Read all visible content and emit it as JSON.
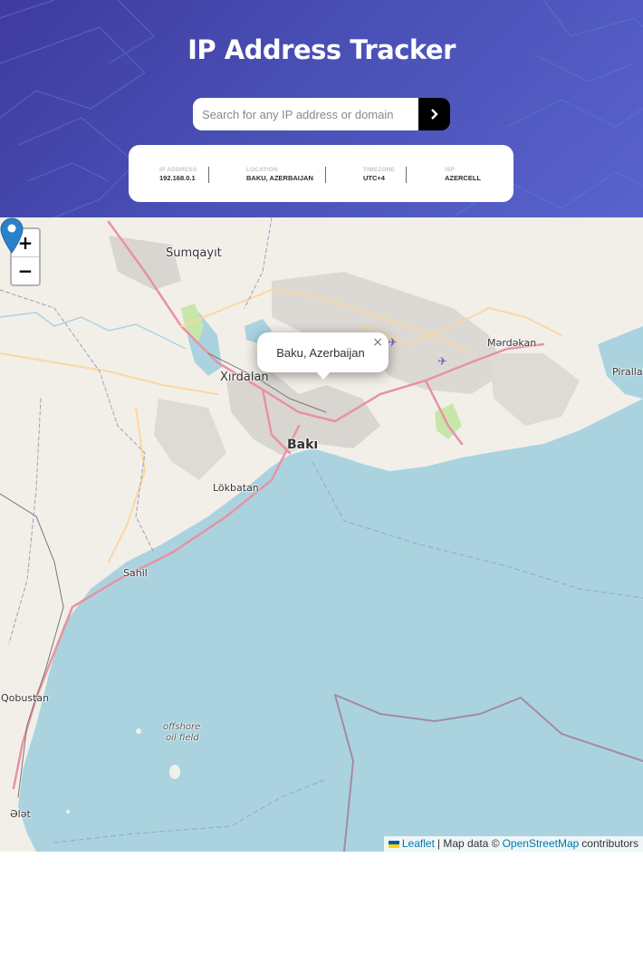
{
  "header": {
    "title": "IP Address Tracker",
    "search_placeholder": "Search for any IP address or domain",
    "search_value": ""
  },
  "info": {
    "ip_label": "IP ADDRESS",
    "ip_value": "192.168.0.1",
    "location_label": "LOCATION",
    "location_value": "BAKU, AZERBAIJAN",
    "timezone_label": "TIMEZONE",
    "timezone_value": "UTC+4",
    "isp_label": "ISP",
    "isp_value": "AZERCELL"
  },
  "map": {
    "zoom_in": "+",
    "zoom_out": "−",
    "popup_text": "Baku, Azerbaijan",
    "popup_close": "×",
    "places": {
      "sumqayit": "Sumqayıt",
      "mardakan": "Mərdəkan",
      "pirallahi": "Pirallah",
      "xirdalan": "Xırdalan",
      "baki": "Bakı",
      "lokbatan": "Lökbatan",
      "sahil": "Sahil",
      "qobustan": "Qobustan",
      "offshore1": "offshore",
      "offshore2": "oil field",
      "alat": "Ələt"
    },
    "attribution": {
      "leaflet": "Leaflet",
      "sep": "| Map data ©",
      "osm": "OpenStreetMap",
      "contributors": "contributors"
    }
  },
  "colors": {
    "header_gradient_start": "#3f3a9e",
    "header_gradient_end": "#5a63cc",
    "sea": "#aad3df",
    "land": "#f2efe9",
    "marker": "#2a81cb",
    "link": "#0078a8"
  }
}
